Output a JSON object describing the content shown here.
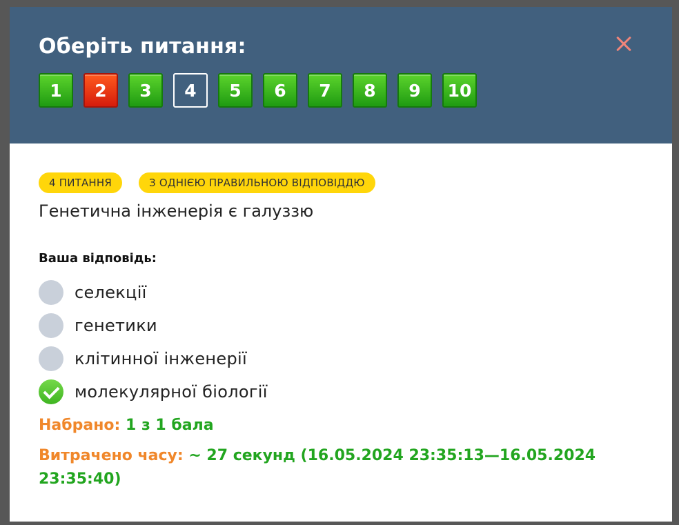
{
  "modal": {
    "title": "Оберіть питання:",
    "questions": [
      {
        "label": "1",
        "state": "correct"
      },
      {
        "label": "2",
        "state": "wrong"
      },
      {
        "label": "3",
        "state": "correct"
      },
      {
        "label": "4",
        "state": "current"
      },
      {
        "label": "5",
        "state": "correct"
      },
      {
        "label": "6",
        "state": "correct"
      },
      {
        "label": "7",
        "state": "correct"
      },
      {
        "label": "8",
        "state": "correct"
      },
      {
        "label": "9",
        "state": "correct"
      },
      {
        "label": "10",
        "state": "correct"
      }
    ]
  },
  "question": {
    "number_badge": "4 ПИТАННЯ",
    "type_badge": "З ОДНІЄЮ ПРАВИЛЬНОЮ ВІДПОВІДДЮ",
    "text": "Генетична інженерія є галуззю",
    "answer_label": "Ваша відповідь:",
    "options": [
      {
        "text": "селекції",
        "checked": false
      },
      {
        "text": "генетики",
        "checked": false
      },
      {
        "text": "клітинної інженерії",
        "checked": false
      },
      {
        "text": "молекулярної біології",
        "checked": true
      }
    ]
  },
  "result": {
    "score_label": "Набрано:",
    "score_value": "1 з 1 бала",
    "time_label": "Витрачено часу:",
    "time_value": "~ 27 секунд (16.05.2024 23:35:13—16.05.2024 23:35:40)"
  },
  "colors": {
    "header_bg": "#41607e",
    "badge_yellow": "#ffd60a",
    "correct_green": "#22a51f",
    "wrong_red": "#e0261a",
    "label_orange": "#f0872a",
    "close_icon": "#f0857a"
  }
}
